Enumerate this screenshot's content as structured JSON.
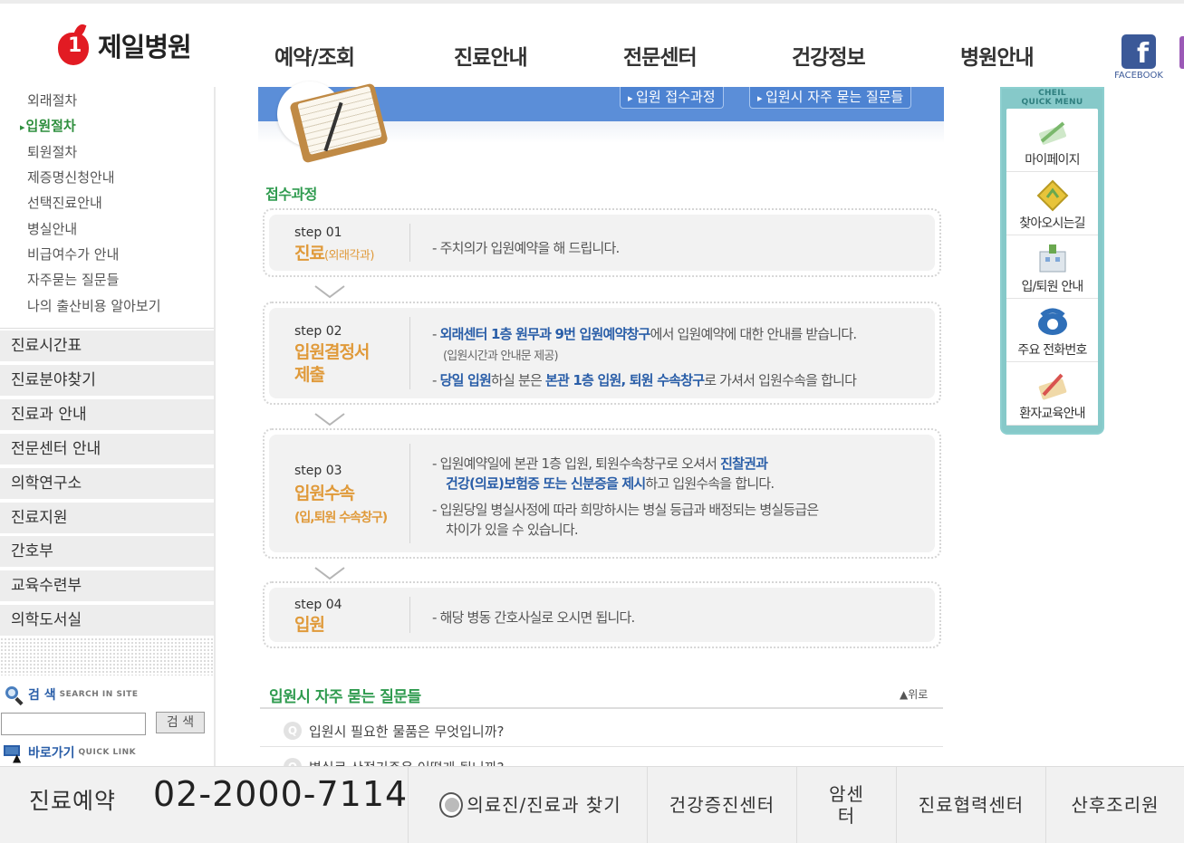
{
  "header": {
    "logo_text": "제일병원",
    "nav": [
      "예약/조회",
      "진료안내",
      "전문센터",
      "건강정보",
      "병원안내"
    ],
    "facebook_label": "FACEBOOK"
  },
  "sidebar": {
    "sub_items": [
      "외래절차",
      "입원절차",
      "퇴원절차",
      "제증명신청안내",
      "선택진료안내",
      "병실안내",
      "비급여수가 안내",
      "자주묻는 질문들",
      "나의 출산비용 알아보기"
    ],
    "menu": [
      "진료시간표",
      "진료분야찾기",
      "진료과 안내",
      "전문센터 안내",
      "의학연구소",
      "진료지원",
      "간호부",
      "교육수련부",
      "의학도서실"
    ],
    "search_title": "검 색",
    "search_sub": "SEARCH IN SITE",
    "search_button": "검 색",
    "search_value": "",
    "quick_title": "바로가기",
    "quick_sub": "QUICK LINK"
  },
  "content": {
    "tabs": [
      "입원 접수과정",
      "입원시 자주 묻는 질문들"
    ],
    "section_title": "접수과정",
    "steps": [
      {
        "no": "step 01",
        "title": "진료",
        "title_small": "(외래각과)",
        "lines": [
          {
            "pre": "- 주치의가 입원예약을 해 드립니다."
          }
        ]
      },
      {
        "no": "step 02",
        "title": "입원결정서",
        "title2": "제출",
        "lines": [
          {
            "b1": "외래센터 1층 원무과 9번 입원예약창구",
            "pre": "- ",
            "t1": "에서 입원예약에 대한 안내를 받습니다."
          },
          {
            "pre": "(입원시간과 안내문 제공)"
          },
          {
            "pre": "- ",
            "b1": "당일 입원",
            "t1": "하실 분은 ",
            "b2": "본관 1층 입원, 퇴원 수속창구",
            "t2": "로 가셔서 입원수속을 합니다"
          }
        ]
      },
      {
        "no": "step 03",
        "title": "입원수속",
        "subtitle": "(입,퇴원 수속창구)",
        "lines": [
          {
            "pre": "- 입원예약일에 본관 1층 입원, 퇴원수속창구로 오셔서 ",
            "b1": "진찰권과"
          },
          {
            "b1": "건강(의료)보험증 또는 신분증을 제시",
            "t1": "하고 입원수속을 합니다."
          },
          {
            "pre": "- 입원당일 병실사정에 따라 희망하시는 병실 등급과 배정되는 병실등급은"
          },
          {
            "pre": "차이가 있을 수 있습니다."
          }
        ]
      },
      {
        "no": "step 04",
        "title": "입원",
        "lines": [
          {
            "pre": "- 해당 병동 간호사실로 오시면 됩니다."
          }
        ]
      }
    ],
    "faq_title": "입원시 자주 묻는 질문들",
    "faq_top": "▲위로",
    "faq_marker": "Q",
    "faq": [
      "입원시 필요한 물품은 무엇입니까?",
      "병실료 산정기준은 어떻게 됩니까?"
    ]
  },
  "quick_menu": {
    "head1": "CHEIL",
    "head2": "QUICK MENU",
    "items": [
      "마이페이지",
      "찾아오시는길",
      "입/퇴원 안내",
      "주요 전화번호",
      "환자교육안내"
    ]
  },
  "bottom": {
    "label": "진료예약",
    "phone": "02-2000-7114",
    "links": [
      "의료진/진료과 찾기",
      "건강증진센터",
      "암센터",
      "진료협력센터",
      "산후조리원"
    ]
  },
  "colors": {
    "green": "#2f9b4f",
    "orange": "#e09a3a",
    "blue": "#2a5ea8",
    "banner": "#5b8ed8",
    "quick_menu": "#86c9c9"
  }
}
